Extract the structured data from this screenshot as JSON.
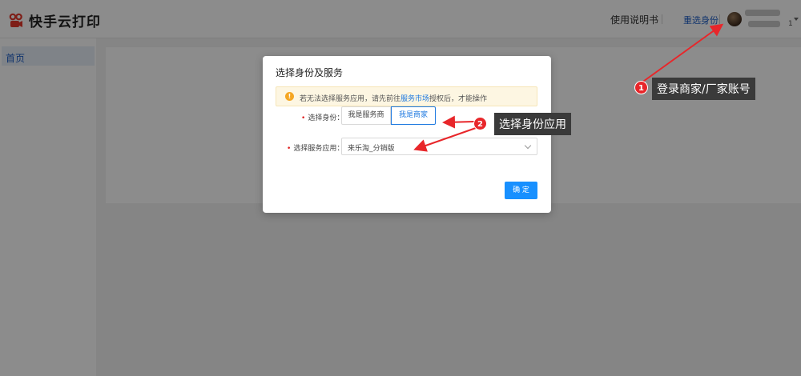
{
  "header": {
    "logo_text": "快手云打印",
    "manual_link": "使用说明书",
    "reselect_link": "重选身份",
    "user_id": "1"
  },
  "sidebar": {
    "items": [
      {
        "label": "首页"
      }
    ]
  },
  "modal": {
    "title": "选择身份及服务",
    "alert": {
      "icon": "!",
      "text_before": "若无法选择服务应用，请先前往",
      "link": "服务市场",
      "text_after": "授权后，才能操作"
    },
    "identity_label": "选择身份：",
    "identity_options": [
      "我是服务商",
      "我是商家"
    ],
    "identity_selected": "我是商家",
    "service_label": "选择服务应用：",
    "service_value": "来乐淘_分销版",
    "confirm_label": "确 定"
  },
  "annotations": [
    {
      "number": "1",
      "text": "登录商家/厂家账号"
    },
    {
      "number": "2",
      "text": "选择身份应用"
    }
  ],
  "colors": {
    "accent": "#1890ff",
    "link": "#1f7ae0",
    "annotation_red": "#e8262a",
    "logo_red": "#e5372b"
  }
}
